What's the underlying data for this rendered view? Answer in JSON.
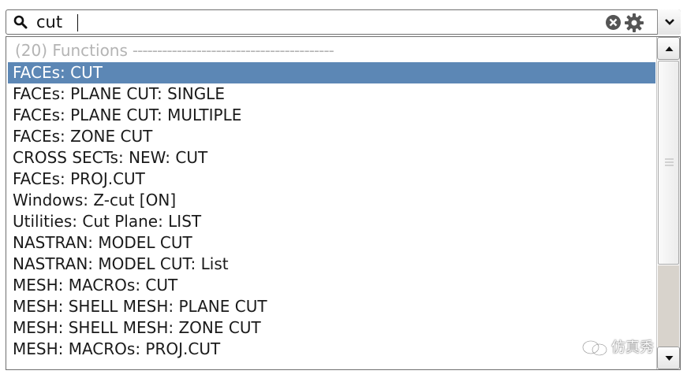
{
  "search": {
    "value": "cut",
    "icons": {
      "search": "magnifier-icon",
      "clear": "clear-circle-x-icon",
      "settings": "gear-icon",
      "dropdown": "chevron-down-icon"
    }
  },
  "results": {
    "header_label": "(20) Functions",
    "header_dashes": "-----------------------------------------",
    "items": [
      "FACEs: CUT",
      "FACEs: PLANE CUT: SINGLE",
      "FACEs: PLANE CUT: MULTIPLE",
      "FACEs: ZONE CUT",
      "CROSS SECTs: NEW: CUT",
      "FACEs: PROJ.CUT",
      "Windows: Z-cut [ON]",
      "Utilities: Cut Plane: LIST",
      "NASTRAN: MODEL CUT",
      "NASTRAN: MODEL CUT: List",
      "MESH: MACROs: CUT",
      "MESH: SHELL MESH: PLANE CUT",
      "MESH: SHELL MESH: ZONE CUT",
      "MESH: MACROs: PROJ.CUT"
    ],
    "selected_index": 0
  },
  "watermark": {
    "text": "仿真秀"
  },
  "colors": {
    "selection": "#5c87b5",
    "header_text": "#b4b4b4",
    "scroll_track": "#d8d3cc"
  }
}
